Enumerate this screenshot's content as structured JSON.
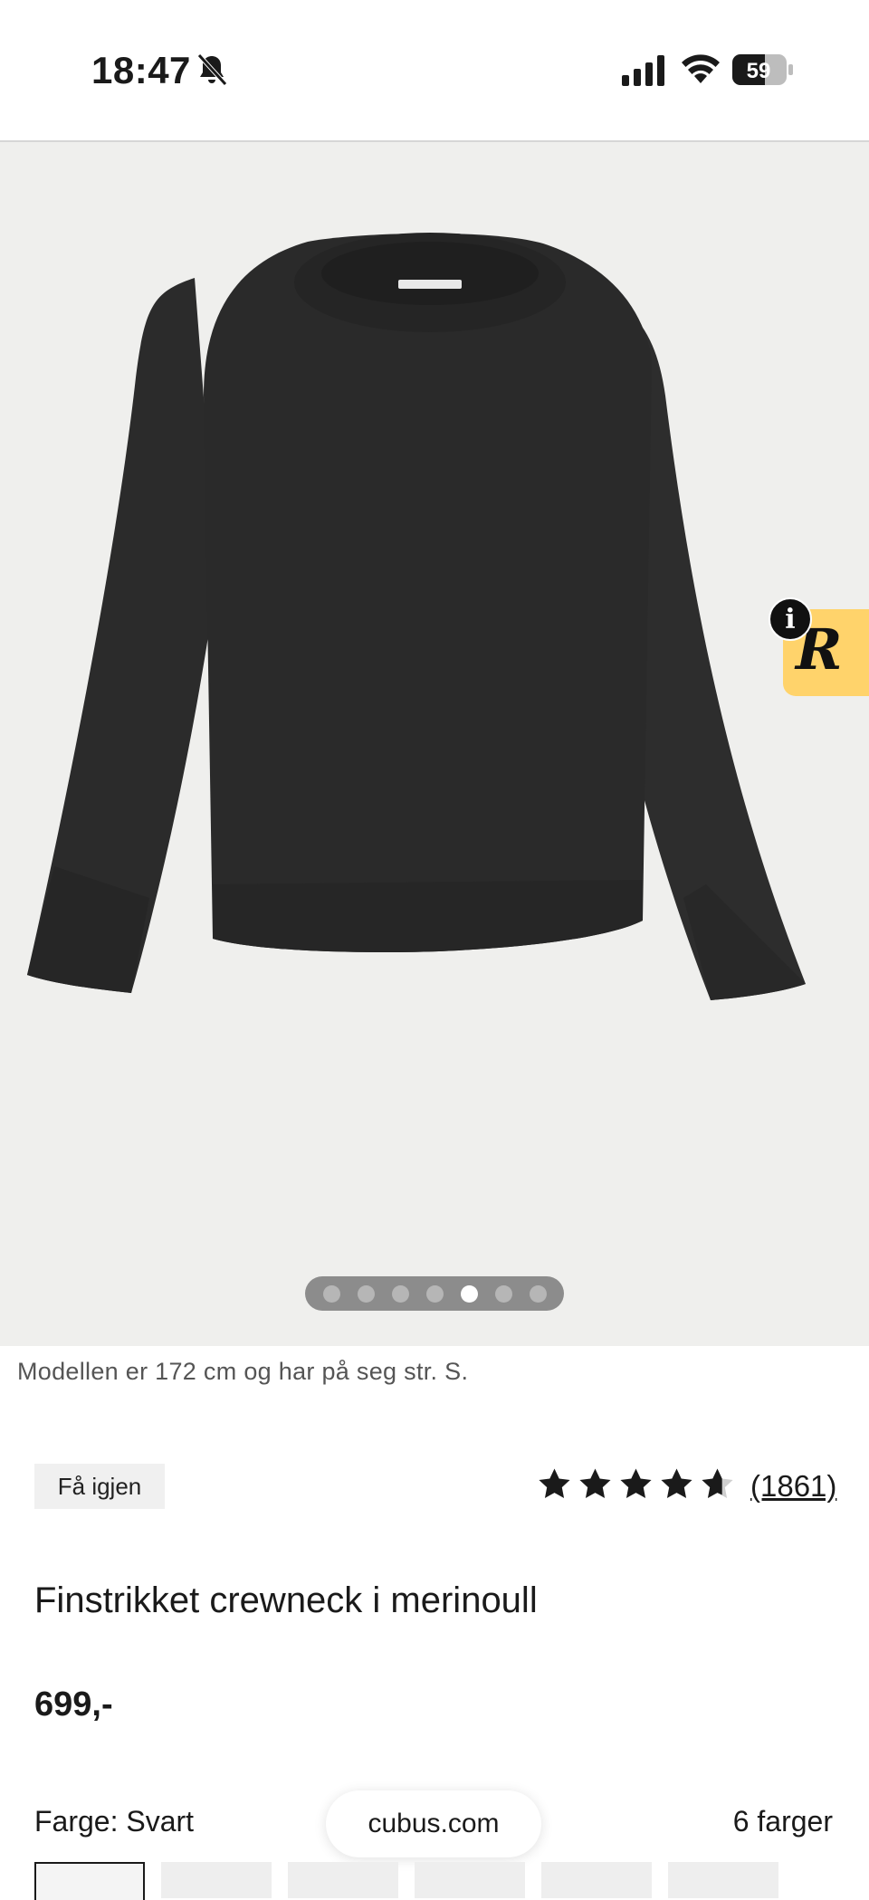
{
  "status_bar": {
    "time": "18:47",
    "battery": "59"
  },
  "gallery": {
    "dot_count": 7,
    "active_dot_index": 4
  },
  "model_note": "Modellen er 172 cm og har på seg str. S.",
  "tag": "Få igjen",
  "rating": {
    "stars": 4.5,
    "count": "(1861)"
  },
  "product": {
    "title": "Finstrikket crewneck i merinoull",
    "price": "699,-"
  },
  "color": {
    "label": "Farge: Svart",
    "count": "6 farger"
  },
  "url_pill": "cubus.com",
  "colors": {
    "accent_badge": "#ffd36b",
    "sweater": "#2b2b2b"
  }
}
